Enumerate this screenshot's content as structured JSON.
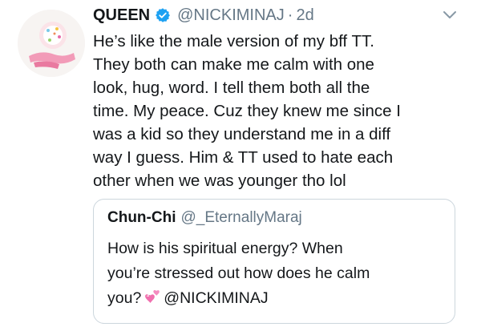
{
  "tweet": {
    "display_name": "QUEEN",
    "verified_icon": "verified-badge-icon",
    "handle": "@NICKIMINAJ",
    "separator": "·",
    "timestamp": "2d",
    "menu_icon": "chevron-down-icon",
    "text_lines": [
      "He’s like the male version of my bff TT.",
      "They both can make me calm with one",
      "look, hug, word. I tell them both all the",
      "time. My peace. Cuz they knew me since I",
      "was a kid so they understand me in a diff",
      "way I guess. Him & TT used to hate each",
      "other when we was younger tho lol"
    ]
  },
  "quoted_tweet": {
    "display_name": "Chun-Chi",
    "handle": "@_EternallyMaraj",
    "text_lines": [
      "How is his spiritual energy? When",
      "you’re stressed out how does he calm"
    ],
    "last_line_start": "you?",
    "emoji_icon": "two-hearts-emoji-icon",
    "last_line_end": "@NICKIMINAJ"
  },
  "colors": {
    "text_primary": "#14171a",
    "text_secondary": "#657786",
    "verified_blue": "#1da1f2",
    "border": "#ccd6dd",
    "emoji_pink": "#f06fae"
  }
}
